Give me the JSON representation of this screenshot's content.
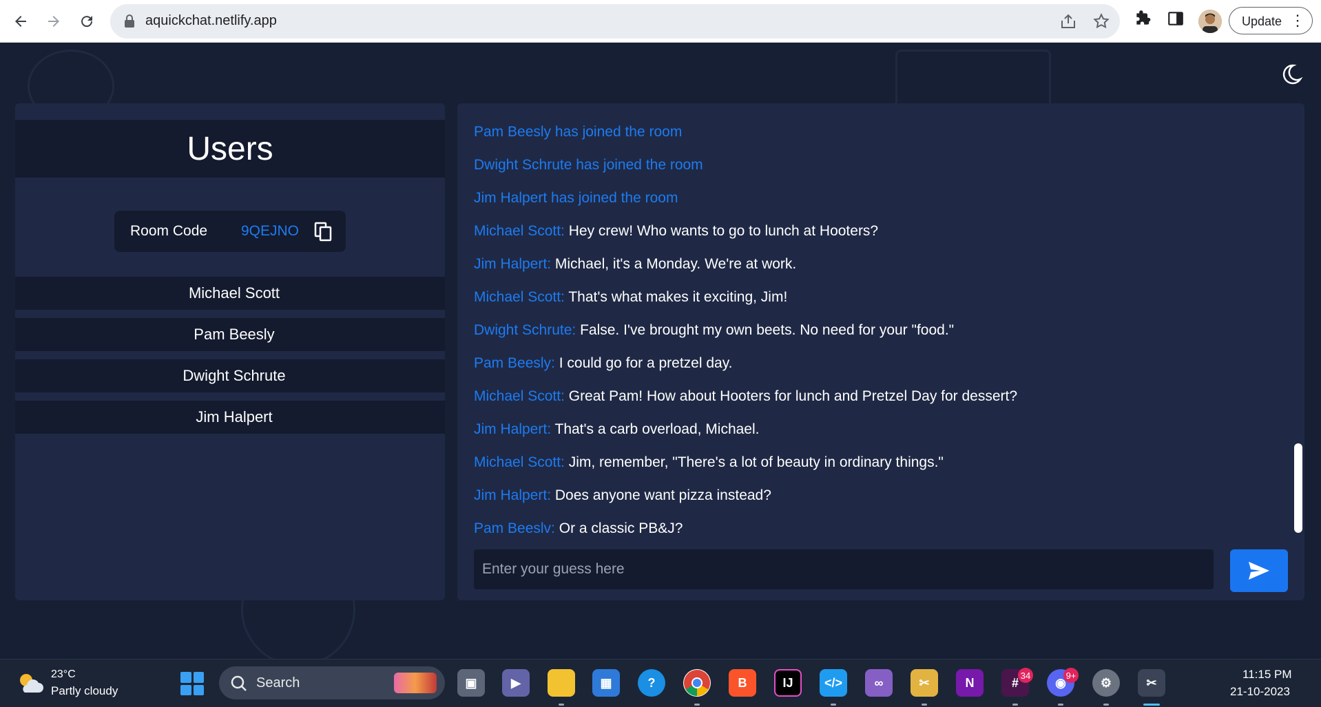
{
  "browser": {
    "url": "aquickchat.netlify.app",
    "update_label": "Update"
  },
  "users_panel": {
    "title": "Users",
    "room_code_label": "Room Code",
    "room_code": "9QEJNO",
    "users": [
      "Michael Scott",
      "Pam Beesly",
      "Dwight Schrute",
      "Jim Halpert"
    ]
  },
  "chat": {
    "messages": [
      {
        "text": "Pam Beesly has joined the room"
      },
      {
        "text": "Dwight Schrute has joined the room"
      },
      {
        "text": "Jim Halpert has joined the room"
      },
      {
        "sender": "Michael Scott:",
        "text": "Hey crew! Who wants to go to lunch at Hooters?"
      },
      {
        "sender": "Jim Halpert:",
        "text": "Michael, it's a Monday. We're at work."
      },
      {
        "sender": "Michael Scott:",
        "text": "That's what makes it exciting, Jim!"
      },
      {
        "sender": "Dwight Schrute:",
        "text": "False. I've brought my own beets. No need for your \"food.\""
      },
      {
        "sender": "Pam Beesly:",
        "text": "I could go for a pretzel day."
      },
      {
        "sender": "Michael Scott:",
        "text": "Great Pam! How about Hooters for lunch and Pretzel Day for dessert?"
      },
      {
        "sender": "Jim Halpert:",
        "text": "That's a carb overload, Michael."
      },
      {
        "sender": "Michael Scott:",
        "text": "Jim, remember, \"There's a lot of beauty in ordinary things.\""
      },
      {
        "sender": "Jim Halpert:",
        "text": "Does anyone want pizza instead?"
      },
      {
        "sender": "Pam Beeslv:",
        "text": "Or a classic PB&J?"
      }
    ],
    "input_placeholder": "Enter your guess here",
    "accent_color": "#1d7bf2"
  },
  "taskbar": {
    "weather_temp": "23°C",
    "weather_desc": "Partly cloudy",
    "search_label": "Search",
    "slack_badge": "34",
    "discord_badge": "9+",
    "time": "11:15 PM",
    "date": "21-10-2023",
    "apps": [
      "task-view-icon",
      "teams-icon",
      "file-explorer-icon",
      "store-icon",
      "tips-icon",
      "chrome-icon",
      "brave-icon",
      "intellij-icon",
      "vscode-icon",
      "visual-studio-icon",
      "tools-icon",
      "onenote-icon",
      "slack-icon",
      "discord-icon",
      "settings-icon",
      "snipping-tool-icon"
    ]
  }
}
